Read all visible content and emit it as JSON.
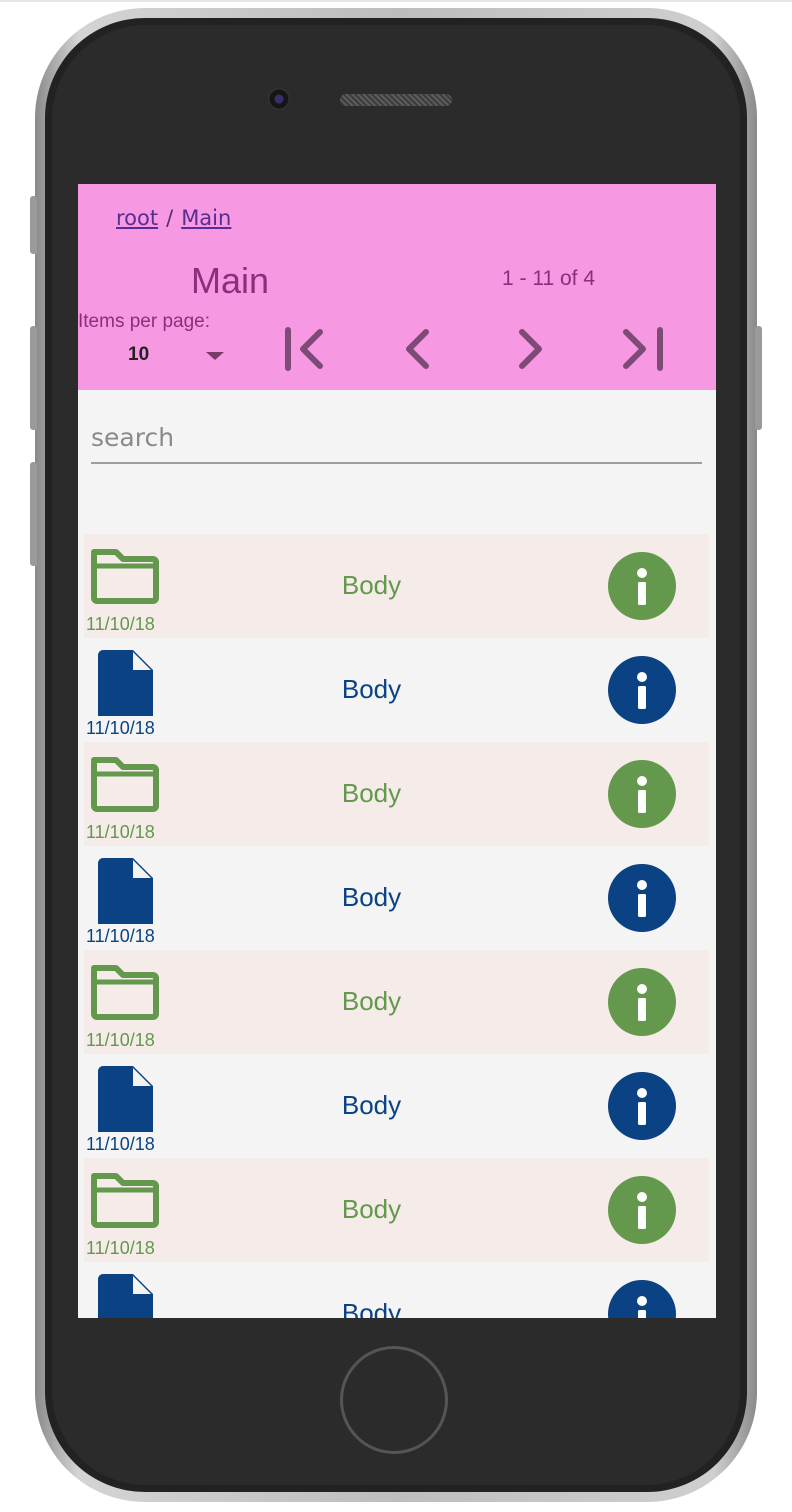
{
  "breadcrumb": {
    "root": "root",
    "separator": "/",
    "current": "Main"
  },
  "header": {
    "title": "Main",
    "range": "1 - 11 of 4"
  },
  "items_per_page": {
    "label": "Items per page:",
    "value": "10"
  },
  "pager": {
    "first_icon": "first-page-icon",
    "prev_icon": "chevron-left-icon",
    "next_icon": "chevron-right-icon",
    "last_icon": "last-page-icon"
  },
  "search": {
    "placeholder": "search",
    "value": ""
  },
  "colors": {
    "header_bg": "#f799e2",
    "accent": "#8f2d7c",
    "folder_green": "#64984d",
    "file_blue": "#0a4283",
    "folder_row_bg": "#f5ecea",
    "file_row_bg": "#f4f4f4"
  },
  "items": [
    {
      "kind": "folder",
      "icon": "folder-icon",
      "name": "Body",
      "date": "11/10/18"
    },
    {
      "kind": "file",
      "icon": "file-icon",
      "name": "Body",
      "date": "11/10/18"
    },
    {
      "kind": "folder",
      "icon": "folder-icon",
      "name": "Body",
      "date": "11/10/18"
    },
    {
      "kind": "file",
      "icon": "file-icon",
      "name": "Body",
      "date": "11/10/18"
    },
    {
      "kind": "folder",
      "icon": "folder-icon",
      "name": "Body",
      "date": "11/10/18"
    },
    {
      "kind": "file",
      "icon": "file-icon",
      "name": "Body",
      "date": "11/10/18"
    },
    {
      "kind": "folder",
      "icon": "folder-icon",
      "name": "Body",
      "date": "11/10/18"
    },
    {
      "kind": "file",
      "icon": "file-icon",
      "name": "Body",
      "date": ""
    }
  ]
}
